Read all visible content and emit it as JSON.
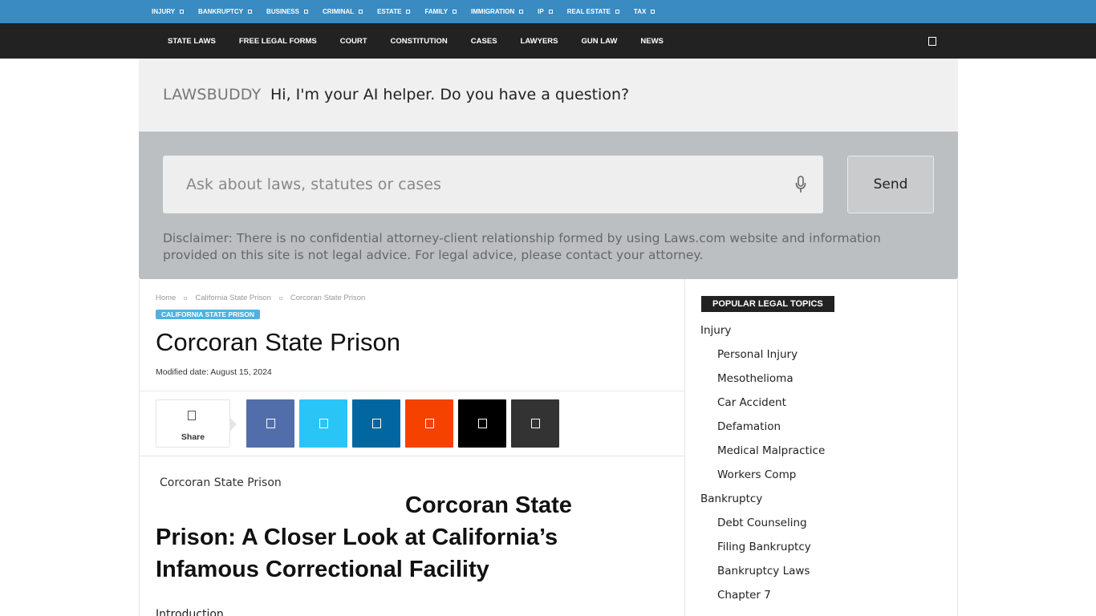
{
  "topbar": {
    "items": [
      "INJURY",
      "BANKRUPTCY",
      "BUSINESS",
      "CRIMINAL",
      "ESTATE",
      "FAMILY",
      "IMMIGRATION",
      "IP",
      "REAL ESTATE",
      "TAX"
    ]
  },
  "mainnav": {
    "items": [
      "STATE LAWS",
      "FREE LEGAL FORMS",
      "COURT",
      "CONSTITUTION",
      "CASES",
      "LAWYERS",
      "GUN LAW",
      "NEWS"
    ],
    "search_icon": "search-icon"
  },
  "ai_helper": {
    "brand": "LAWSBUDDY",
    "greeting": "Hi, I'm your AI helper. Do you have a question?",
    "input_placeholder": "Ask about laws, statutes or cases",
    "send_label": "Send",
    "disclaimer": "Disclaimer: There is no confidential attorney-client relationship formed by using Laws.com website and information provided on this site is not legal advice. For legal advice, please contact your attorney."
  },
  "article": {
    "breadcrumb": [
      "Home",
      "California State Prison",
      "Corcoran State Prison"
    ],
    "category": "CALIFORNIA STATE PRISON",
    "title": "Corcoran State Prison",
    "modified": "Modified date: August 15, 2024",
    "share_label": "Share",
    "share_buttons": [
      {
        "name": "facebook",
        "color": "#516eab"
      },
      {
        "name": "twitter",
        "color": "#29c5f6"
      },
      {
        "name": "linkedin",
        "color": "#0266a0"
      },
      {
        "name": "reddit",
        "color": "#f54200"
      },
      {
        "name": "x",
        "color": "#000000"
      },
      {
        "name": "copy-link",
        "color": "#333333"
      }
    ],
    "image_alt": "Corcoran State Prison",
    "heading": [
      "Corcoran State",
      "Prison: A Closer Look at California’s",
      "Infamous Correctional Facility"
    ],
    "intro": "Introduction"
  },
  "sidebar": {
    "title": "POPULAR LEGAL TOPICS",
    "topics": [
      {
        "label": "Injury",
        "sub": false
      },
      {
        "label": "Personal Injury",
        "sub": true
      },
      {
        "label": "Mesothelioma",
        "sub": true
      },
      {
        "label": "Car Accident",
        "sub": true
      },
      {
        "label": "Defamation",
        "sub": true
      },
      {
        "label": "Medical Malpractice",
        "sub": true
      },
      {
        "label": "Workers Comp",
        "sub": true
      },
      {
        "label": "Bankruptcy",
        "sub": false
      },
      {
        "label": "Debt Counseling",
        "sub": true
      },
      {
        "label": "Filing Bankruptcy",
        "sub": true
      },
      {
        "label": "Bankruptcy Laws",
        "sub": true
      },
      {
        "label": "Chapter 7",
        "sub": true
      }
    ]
  },
  "colors": {
    "topbar_bg": "#3a8bc2",
    "nav_bg": "#222222",
    "badge_bg": "#4fb1e0"
  }
}
